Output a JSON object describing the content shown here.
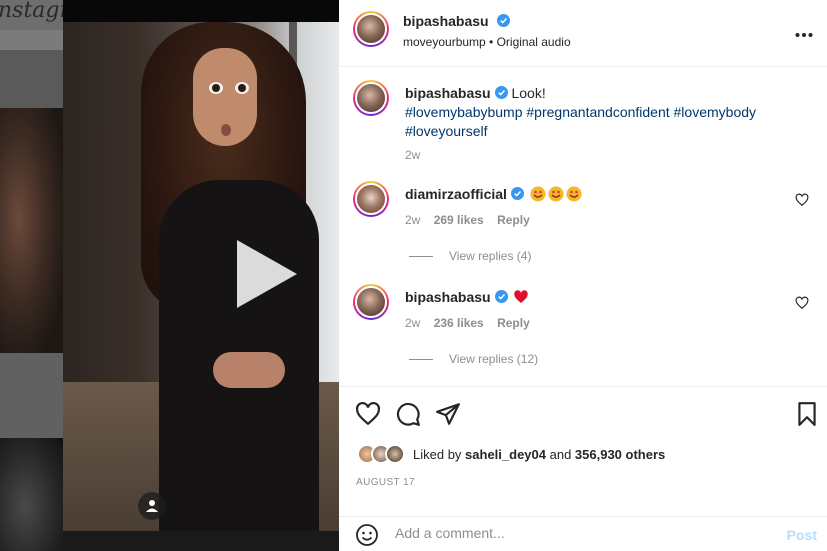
{
  "backdrop": {
    "script_text": "nstagr"
  },
  "post": {
    "username": "bipashabasu",
    "audio_line": "moveyourbump • Original audio",
    "more_icon": "more-horizontal-icon"
  },
  "caption": {
    "username": "bipashabasu",
    "text": "Look!",
    "hashtags": "#lovemybabybump #pregnantandconfident #lovemybody #loveyourself",
    "time": "2w"
  },
  "comments": [
    {
      "username": "diamirzaofficial",
      "emojis": [
        "smiling-face-with-hearts",
        "smiling-face-with-hearts",
        "smiling-face-with-hearts"
      ],
      "time": "2w",
      "likes": "269 likes",
      "reply": "Reply",
      "view_replies": "View replies (4)"
    },
    {
      "username": "bipashabasu",
      "emojis": [
        "red-heart"
      ],
      "time": "2w",
      "likes": "236 likes",
      "reply": "Reply",
      "view_replies": "View replies (12)"
    }
  ],
  "actions": {
    "liked_prefix": "Liked by ",
    "liked_user": "saheli_dey04",
    "liked_and": " and ",
    "liked_others": "356,930 others",
    "date": "AUGUST 17"
  },
  "add_comment": {
    "placeholder": "Add a comment...",
    "post_label": "Post"
  },
  "colors": {
    "link_blue": "#00376b",
    "verified_blue": "#3897f0",
    "post_disabled": "#b2dffc",
    "heart_red": "#ed4956"
  }
}
